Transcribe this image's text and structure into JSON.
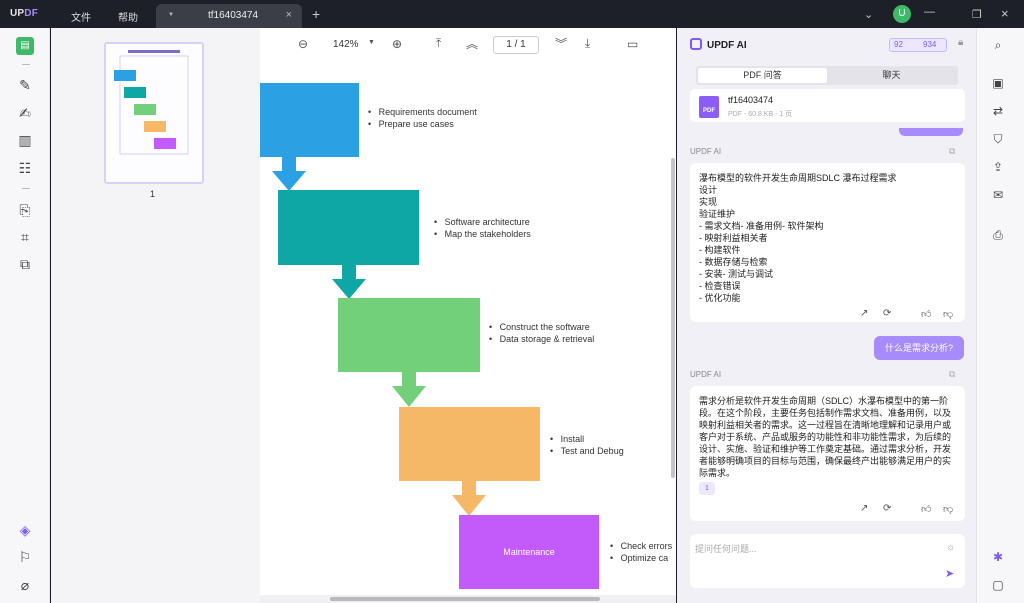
{
  "app": {
    "logo_up": "UP",
    "logo_df": "DF",
    "menu": [
      "文件",
      "帮助"
    ]
  },
  "tab": {
    "name": "tf16403474",
    "close": "×",
    "new": "+"
  },
  "window": {
    "avatar": "U"
  },
  "thumbnail": {
    "page_number": "1"
  },
  "toolbar": {
    "zoom": "142%",
    "page_current": "1",
    "page_sep": "/",
    "page_total": "1"
  },
  "document": {
    "boxes": [
      {
        "label": "",
        "color": "#2ba1e4",
        "bullets": [
          "Requirements document",
          "Prepare use cases"
        ]
      },
      {
        "label": "",
        "color": "#0fa6a6",
        "bullets": [
          "Software architecture",
          "Map the stakeholders"
        ]
      },
      {
        "label": "",
        "color": "#72d07a",
        "bullets": [
          "Construct the software",
          "Data storage & retrieval"
        ]
      },
      {
        "label": "",
        "color": "#f4b866",
        "bullets": [
          "Install",
          "Test and Debug"
        ]
      },
      {
        "label": "Maintenance",
        "color": "#c25bfa",
        "bullets": [
          "Check errors",
          "Optimize ca"
        ]
      }
    ]
  },
  "ai": {
    "title": "UPDF AI",
    "count_a": "92",
    "count_b": "934",
    "tabs": [
      "PDF 问答",
      "聊天"
    ],
    "file": {
      "name": "tf16403474",
      "meta": "PDF - 60.8 KB - 1 页",
      "icon_text": "PDF"
    },
    "label": "UPDF AI",
    "answer1": "瀑布模型的软件开发生命周期SDLC 瀑布过程需求\n设计\n实现\n验证维护\n- 需求文档- 准备用例- 软件架构\n- 映射利益相关者\n- 构建软件\n- 数据存储与检索\n- 安装- 测试与调试\n- 检查错误\n- 优化功能",
    "question": "什么是需求分析?",
    "answer2": "需求分析是软件开发生命周期（SDLC）水瀑布模型中的第一阶段。在这个阶段，主要任务包括制作需求文档、准备用例，以及映射利益相关者的需求。这一过程旨在清晰地理解和记录用户或客户对于系统、产品或服务的功能性和非功能性需求，为后续的设计、实施、验证和维护等工作奠定基础。通过需求分析，开发者能够明确项目的目标与范围，确保最终产出能够满足用户的实际需求。",
    "ref": "1",
    "input_placeholder": "提问任何问题..."
  },
  "colors": {
    "accent": "#7d5cf0",
    "accent_light": "#a78bfa"
  }
}
